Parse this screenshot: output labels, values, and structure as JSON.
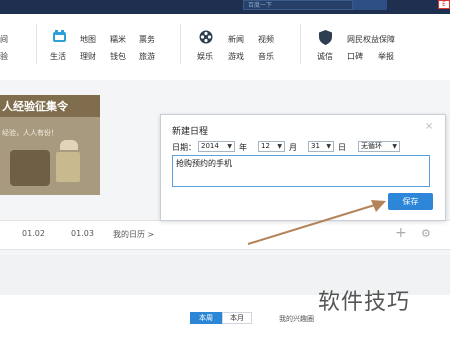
{
  "topbar": {
    "search_placeholder": "百度一下",
    "search_button": "",
    "badge": "E"
  },
  "nav": {
    "left_partial_top": "间",
    "left_partial_bottom": "验",
    "life_label": "生活",
    "life_links": [
      [
        "地图",
        "糯米",
        "票务"
      ],
      [
        "理财",
        "钱包",
        "旅游"
      ]
    ],
    "ent_label": "娱乐",
    "ent_links": [
      [
        "新闻",
        "视频"
      ],
      [
        "游戏",
        "音乐"
      ]
    ],
    "trust_label": "诚信",
    "trust_links": [
      "网民权益保障",
      "口碑",
      "举报"
    ]
  },
  "promo": {
    "title": "人经验征集令",
    "subtitle": "经验，人人有份！"
  },
  "calendar": {
    "items": [
      "01.02",
      "01.03",
      "我的日历 >"
    ],
    "plus": "+",
    "gear": "⚙"
  },
  "dialog": {
    "title": "新建日程",
    "date_label": "日期：",
    "year": "2014",
    "year_unit": "年",
    "month": "12",
    "month_unit": "月",
    "day": "31",
    "day_unit": "日",
    "repeat": "无循环",
    "content": "抢购预约的手机",
    "save_label": "保存",
    "close": "×"
  },
  "tabs": {
    "week": "本周",
    "month": "本月"
  },
  "interest": "我的兴趣圈",
  "watermark": "软件技巧",
  "colors": {
    "accent": "#2d86d8",
    "topbar": "#1f2f4f",
    "annotation_arrow": "#b5835a"
  }
}
